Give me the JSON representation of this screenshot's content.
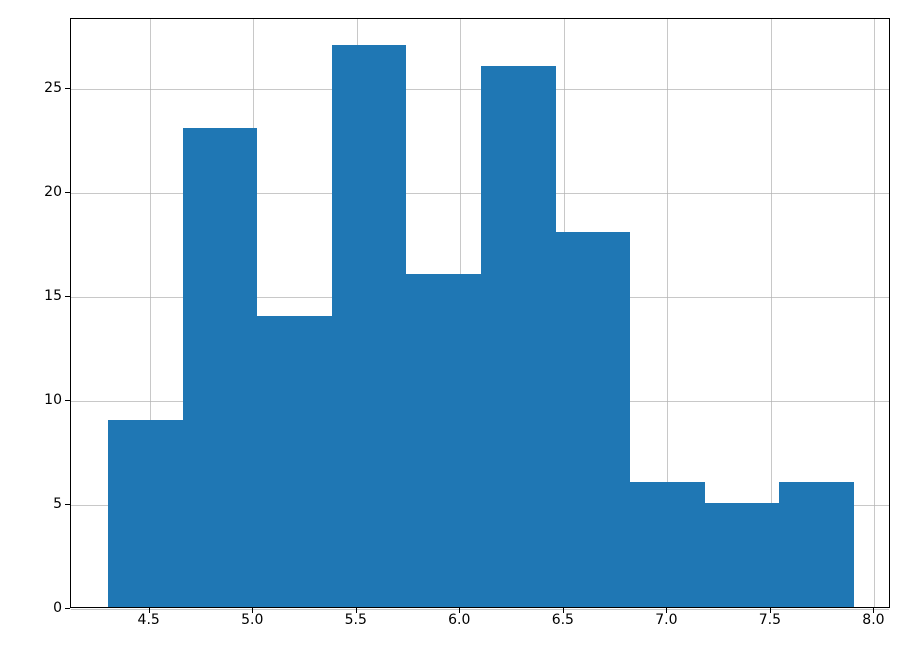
{
  "chart_data": {
    "type": "bar",
    "subtype": "histogram",
    "bin_edges": [
      4.3,
      4.66,
      5.02,
      5.38,
      5.74,
      6.1,
      6.46,
      6.82,
      7.18,
      7.54,
      7.9
    ],
    "counts": [
      9,
      23,
      14,
      27,
      16,
      26,
      18,
      6,
      5,
      6
    ],
    "x_ticks": [
      4.5,
      5.0,
      5.5,
      6.0,
      6.5,
      7.0,
      7.5,
      8.0
    ],
    "y_ticks": [
      0,
      5,
      10,
      15,
      20,
      25
    ],
    "xlim": [
      4.12,
      8.08
    ],
    "ylim": [
      0,
      28.35
    ],
    "title": "",
    "xlabel": "",
    "ylabel": "",
    "grid": true,
    "bar_color": "#1f77b4"
  }
}
